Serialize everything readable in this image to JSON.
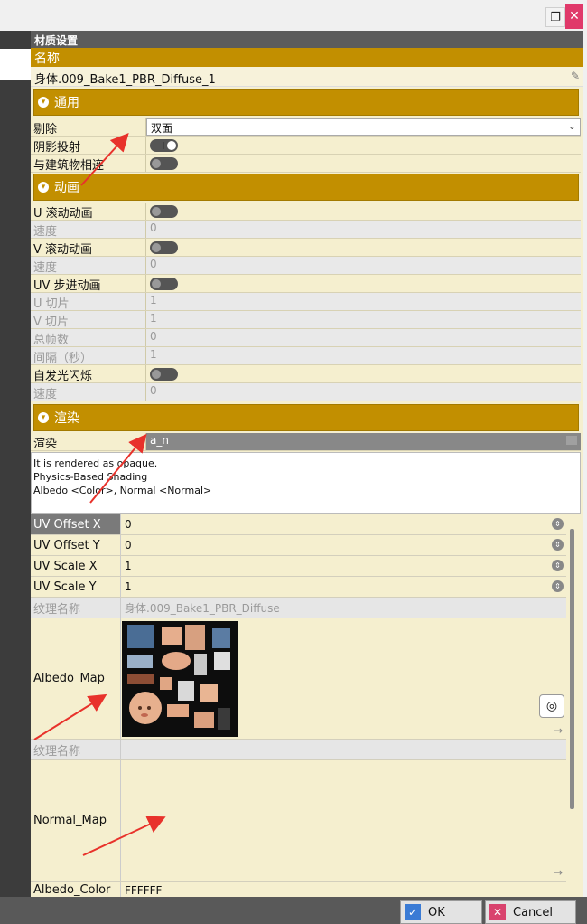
{
  "window": {
    "restore_icon": "restore-icon",
    "close_icon": "close-icon"
  },
  "panel": {
    "title": "材质设置",
    "name_header": "名称",
    "name_value": "身体.009_Bake1_PBR_Diffuse_1",
    "sections": {
      "general": "通用",
      "animation": "动画",
      "render": "渲染"
    },
    "general_rows": [
      {
        "label": "剔除",
        "value": "双面"
      },
      {
        "label": "阴影投射",
        "toggle": "on"
      },
      {
        "label": "与建筑物相连",
        "toggle": "off"
      }
    ],
    "animation_rows": [
      {
        "label": "U 滚动动画",
        "toggle": "off"
      },
      {
        "label": "速度",
        "value": "0"
      },
      {
        "label": "V 滚动动画",
        "toggle": "off"
      },
      {
        "label": "速度",
        "value": "0"
      },
      {
        "label": "UV 步进动画",
        "toggle": "off"
      },
      {
        "label": "U 切片",
        "value": "1"
      },
      {
        "label": "V 切片",
        "value": "1"
      },
      {
        "label": "总帧数",
        "value": "0"
      },
      {
        "label": "间隔（秒）",
        "value": "1"
      },
      {
        "label": "自发光闪烁",
        "toggle": "off"
      },
      {
        "label": "速度",
        "value": "0"
      }
    ],
    "render_label": "渲染",
    "render_value": "a_n",
    "description": [
      "It is rendered as opaque.",
      "Physics-Based Shading",
      "Albedo <Color>, Normal <Normal>"
    ],
    "uv_rows": [
      {
        "label": "UV Offset X",
        "value": "0"
      },
      {
        "label": "UV Offset Y",
        "value": "0"
      },
      {
        "label": "UV Scale X",
        "value": "1"
      },
      {
        "label": "UV Scale Y",
        "value": "1"
      }
    ],
    "texture_name_label": "纹理名称",
    "texture_name_value": "身体.009_Bake1_PBR_Diffuse",
    "albedo_map_label": "Albedo_Map",
    "texture_name_label2": "纹理名称",
    "normal_map_label": "Normal_Map",
    "albedo_color_label": "Albedo_Color",
    "albedo_color_value": "FFFFFF"
  },
  "buttons": {
    "ok": "OK",
    "cancel": "Cancel"
  },
  "colors": {
    "accent": "#c28f00",
    "panel_bg": "#f5efcf",
    "annotation_arrow": "#e8322b"
  }
}
